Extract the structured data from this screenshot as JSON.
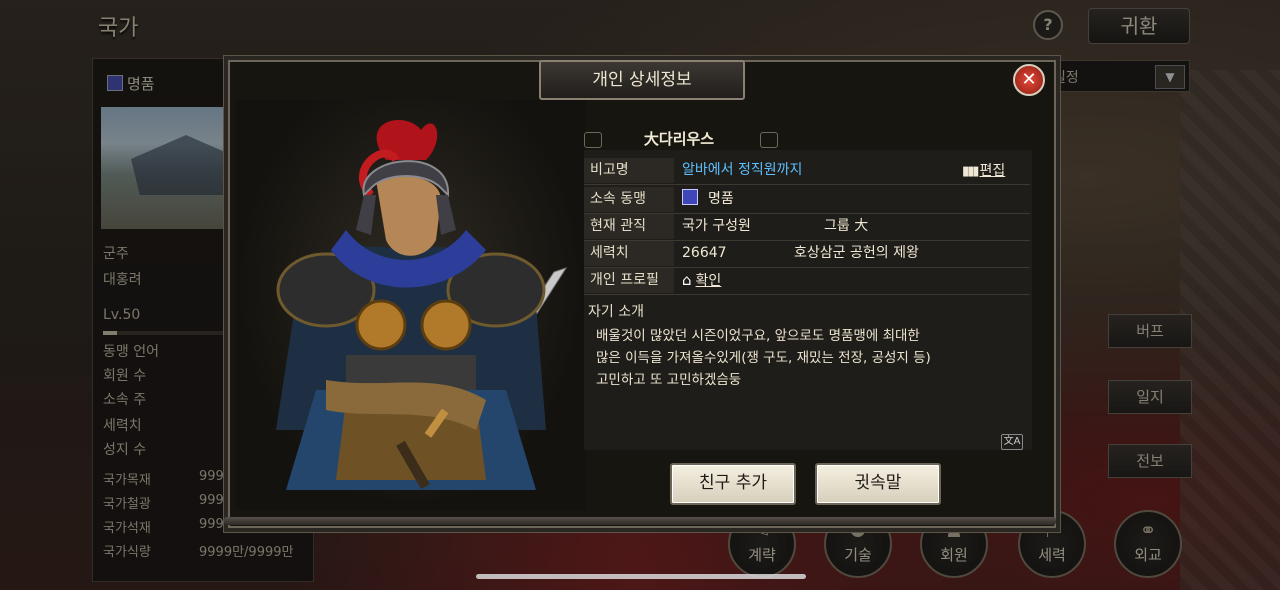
{
  "background": {
    "page_title": "국가",
    "help_label": "?",
    "return_label": "귀환",
    "dropdown_label": "일정",
    "left_panel": {
      "alliance": "명품",
      "rows": [
        "군주",
        "대홍려",
        "Lv.50",
        "동맹 언어",
        "회원 수",
        "소속 주",
        "세력치",
        "성지 수"
      ],
      "resources": [
        "국가목재",
        "국가철광",
        "국가석재",
        "국가식량"
      ],
      "resource_values": [
        "9999",
        "9999",
        "9999",
        "9999만/9999만"
      ]
    },
    "side_buttons": [
      "버프",
      "일지",
      "전보"
    ],
    "bottom_menu": [
      "계략",
      "기술",
      "회원",
      "세력",
      "외교"
    ]
  },
  "modal": {
    "title": "개인 상세정보",
    "close_label": "✕",
    "name": "大다리우스",
    "labels": {
      "nickname": "비고명",
      "alliance": "소속 동맹",
      "position": "현재 관직",
      "power": "세력치",
      "profile": "개인 프로필"
    },
    "nickname": "알바에서 정직원까지",
    "edit_label": "편집",
    "alliance": "명품",
    "position": "국가 구성원",
    "group": "그룹 大",
    "power": "26647",
    "title_prefix": "호상삼군",
    "title_highlight": "공헌의 제왕",
    "profile_link": "확인",
    "intro_heading": "자기 소개",
    "intro_text": "배울것이 많았던 시즌이었구요, 앞으로도 명품맹에 최대한\n많은 이득을 가져올수있게(쟁 구도, 재밌는 전장, 공성지 등)\n고민하고 또 고민하겠슴둥",
    "add_friend": "친구 추가",
    "whisper": "귓속말"
  },
  "colors": {
    "link_blue": "#5dc0ff",
    "title_orange": "#f0a128",
    "close_red": "#d23a2a"
  }
}
